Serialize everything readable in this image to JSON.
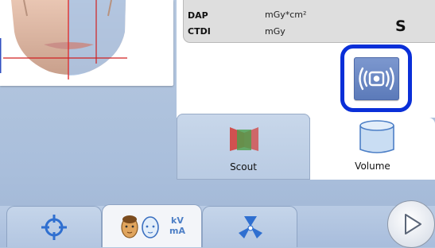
{
  "dose_panel": {
    "dap_label": "DAP",
    "dap_unit": "mGy*cm²",
    "ctdi_label": "CTDI",
    "ctdi_unit": "mGy",
    "size_value": "S"
  },
  "scan_button": {
    "icon": "radiation-emit-icon"
  },
  "mode_tabs": [
    {
      "label": "Scout",
      "icon": "scout-icon",
      "selected": false
    },
    {
      "label": "Volume",
      "icon": "cylinder-icon",
      "selected": true
    }
  ],
  "bottom_tabs": [
    {
      "icon": "crosshair-icon"
    },
    {
      "icon": "patient-heads-icon",
      "text_top": "kV",
      "text_bottom": "mA"
    },
    {
      "icon": "radiation-icon"
    }
  ],
  "next_button": {
    "icon": "play-icon"
  },
  "colors": {
    "highlight_ring": "#0a2fd8",
    "button_blue": "#6683c2",
    "background": "#b3c6de"
  }
}
